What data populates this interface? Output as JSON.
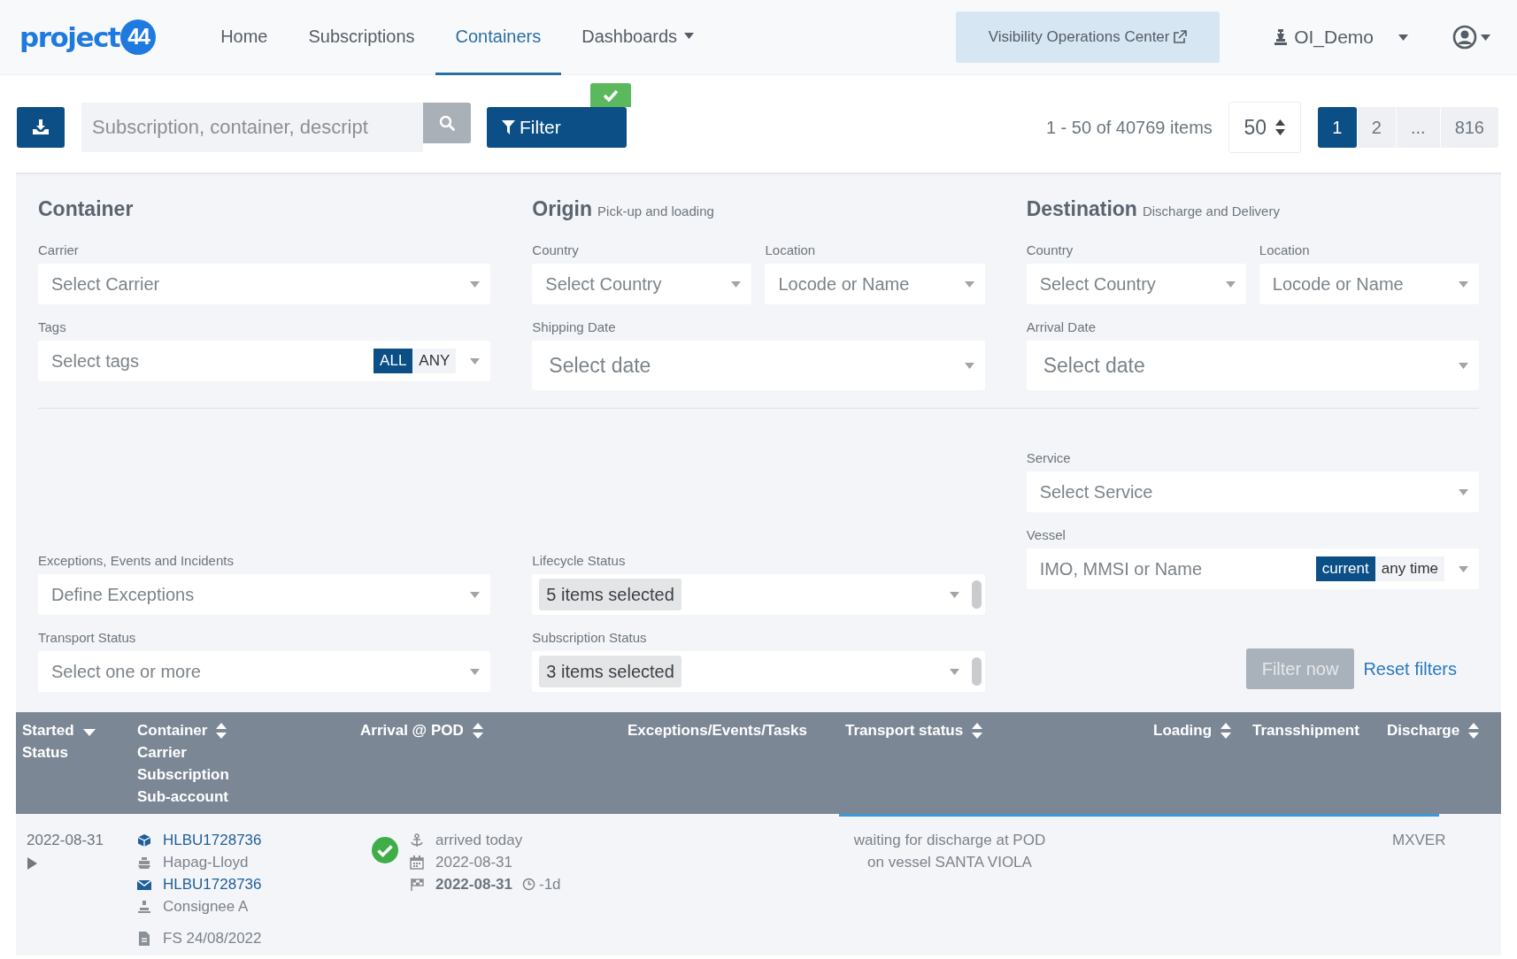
{
  "nav": {
    "logo": {
      "text": "project",
      "badge": "44"
    },
    "items": [
      {
        "label": "Home",
        "selected": false,
        "dropdown": false
      },
      {
        "label": "Subscriptions",
        "selected": false,
        "dropdown": false
      },
      {
        "label": "Containers",
        "selected": true,
        "dropdown": false
      },
      {
        "label": "Dashboards",
        "selected": false,
        "dropdown": true
      }
    ],
    "voc_button": "Visibility Operations Center",
    "user": "OI_Demo"
  },
  "toolbar": {
    "search_placeholder": "Subscription, container, descript",
    "filter_label": "Filter",
    "filter_active": true,
    "count": "1 - 50 of 40769 items",
    "page_size": "50",
    "pages": [
      {
        "label": "1",
        "selected": true
      },
      {
        "label": "2",
        "selected": false
      },
      {
        "label": "...",
        "selected": false
      },
      {
        "label": "816",
        "selected": false
      }
    ]
  },
  "filters": {
    "columns": [
      {
        "title": "Container",
        "top": [
          {
            "kind": "select",
            "label": "Carrier",
            "placeholder": "Select Carrier"
          },
          {
            "kind": "tags",
            "label": "Tags",
            "placeholder": "Select tags",
            "options": [
              {
                "label": "ALL",
                "selected": true
              },
              {
                "label": "ANY",
                "selected": false
              }
            ]
          }
        ],
        "bottom": [
          {
            "kind": "select",
            "label": "Exceptions, Events and Incidents",
            "placeholder": "Define Exceptions"
          },
          {
            "kind": "select",
            "label": "Transport Status",
            "placeholder": "Select one or more"
          }
        ]
      },
      {
        "title": "Origin",
        "subtitle": "Pick-up and loading",
        "top": [
          {
            "kind": "pair",
            "fields": [
              {
                "kind": "select",
                "label": "Country",
                "placeholder": "Select Country"
              },
              {
                "kind": "select",
                "label": "Location",
                "placeholder": "Locode or Name"
              }
            ]
          },
          {
            "kind": "date",
            "label": "Shipping Date",
            "placeholder": "Select date"
          }
        ],
        "bottom": [
          {
            "kind": "multi",
            "label": "Lifecycle Status",
            "value": "5 items selected"
          },
          {
            "kind": "multi",
            "label": "Subscription Status",
            "value": "3 items selected"
          }
        ]
      },
      {
        "title": "Destination",
        "subtitle": "Discharge and Delivery",
        "top": [
          {
            "kind": "pair",
            "fields": [
              {
                "kind": "select",
                "label": "Country",
                "placeholder": "Select Country"
              },
              {
                "kind": "select",
                "label": "Location",
                "placeholder": "Locode or Name"
              }
            ]
          },
          {
            "kind": "date",
            "label": "Arrival Date",
            "placeholder": "Select date"
          }
        ],
        "bottom": [
          {
            "kind": "select",
            "label": "Service",
            "placeholder": "Select Service"
          },
          {
            "kind": "vessel",
            "label": "Vessel",
            "placeholder": "IMO, MMSI or Name",
            "options": [
              {
                "label": "current",
                "selected": true
              },
              {
                "label": "any time",
                "selected": false
              }
            ]
          },
          {
            "kind": "actions",
            "apply": "Filter now",
            "apply_disabled": true,
            "reset": "Reset filters"
          }
        ]
      }
    ]
  },
  "table": {
    "columns": [
      {
        "lines": [
          "Started",
          "Status"
        ],
        "sorted": true
      },
      {
        "lines": [
          "Container",
          "Carrier",
          "Subscription",
          "Sub-account"
        ],
        "sortable": true,
        "sorted": false
      },
      {
        "lines": [
          "Arrival @ POD"
        ],
        "sortable": true,
        "sorted": false
      },
      {
        "lines": [
          "Exceptions/Events/Tasks"
        ],
        "sortable": false,
        "sorted": false
      },
      {
        "lines": [
          "Transport status"
        ],
        "sortable": true,
        "sorted": false
      },
      {
        "lines": [
          "Loading"
        ],
        "sortable": true,
        "sorted": false
      },
      {
        "lines": [
          "Transshipment"
        ],
        "sortable": false,
        "sorted": false
      },
      {
        "lines": [
          "Discharge"
        ],
        "sortable": true,
        "sorted": false
      }
    ],
    "rows": [
      {
        "started": "2022-08-31",
        "expanded": false,
        "container_lines": [
          {
            "kind": "container",
            "text": "HLBU1728736",
            "link": true
          },
          {
            "kind": "carrier",
            "text": "Hapag-Lloyd",
            "link": false
          },
          {
            "kind": "subscription",
            "text": "HLBU1728736",
            "link": true
          },
          {
            "kind": "account",
            "text": "Consignee A",
            "link": false
          },
          {
            "kind": "document",
            "text": "FS 24/08/2022",
            "link": false
          }
        ],
        "arrived": true,
        "arrival_lines": [
          {
            "kind": "anchor",
            "text": "arrived today",
            "bold": false
          },
          {
            "kind": "calendar",
            "text": "2022-08-31",
            "bold": false
          },
          {
            "kind": "flag",
            "text": "2022-08-31",
            "bold": true,
            "delay": "-1d"
          }
        ],
        "transport": [
          "waiting for discharge at POD",
          "on vessel SANTA VIOLA"
        ],
        "discharge": "MXVER"
      }
    ]
  }
}
